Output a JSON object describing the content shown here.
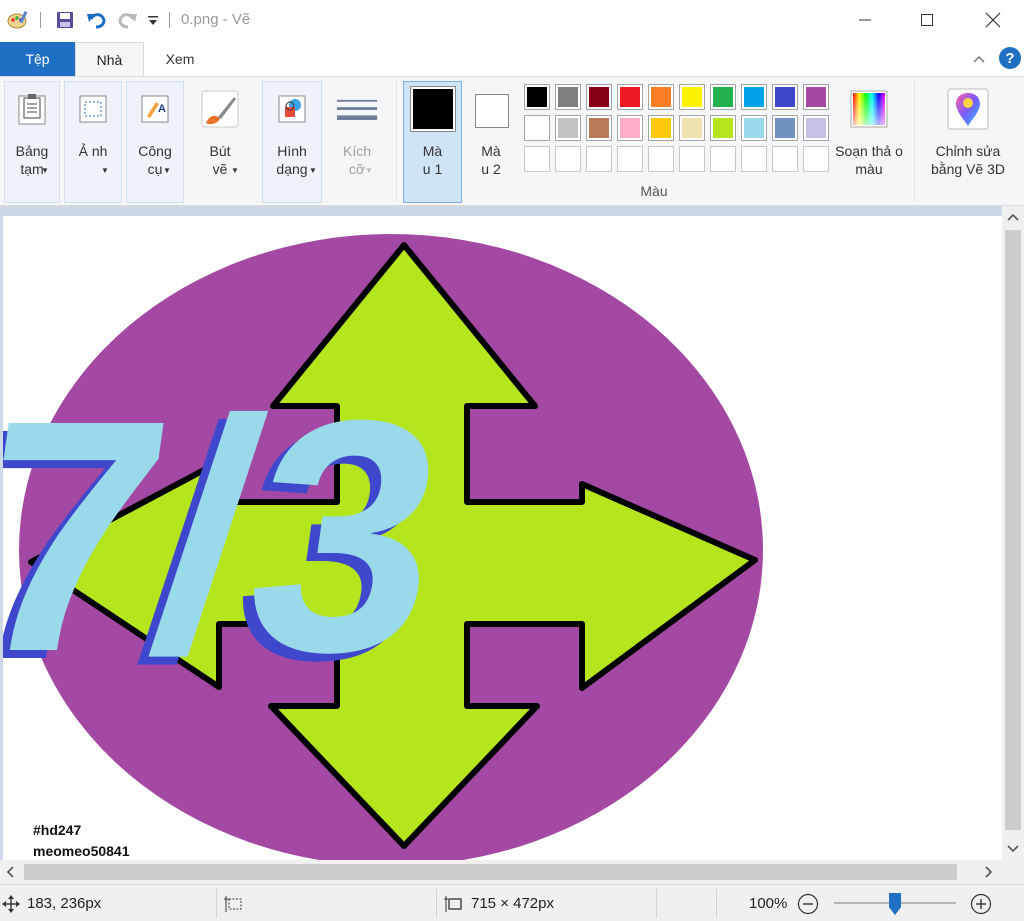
{
  "window": {
    "title": "0.png - Vẽ",
    "min_icon": "minimize-icon",
    "max_icon": "maximize-icon",
    "close_icon": "close-icon"
  },
  "tabs": [
    {
      "label": "Tệp"
    },
    {
      "label": "Nhà"
    },
    {
      "label": "Xem"
    }
  ],
  "ribbon": {
    "clipboard": "Bảng tạm",
    "image": "Ả nh",
    "tools": "Công cụ",
    "brushes": "Bút vẽ",
    "shapes": "Hình dạng",
    "size": "Kích cỡ",
    "color1": "Mà u 1",
    "color2": "Mà u 2",
    "edit_colors": "Soạn thả o màu",
    "paint3d": "Chỉnh sửa bằng Vẽ 3D",
    "colors_group": "Màu"
  },
  "palette_row1": [
    "#000000",
    "#7f7f7f",
    "#880015",
    "#ed1c24",
    "#ff7f27",
    "#fff200",
    "#22b14c",
    "#00a2e8",
    "#3f48cc",
    "#a349a4"
  ],
  "palette_row2": [
    "#ffffff",
    "#c3c3c3",
    "#b97a57",
    "#ffaec9",
    "#ffc90e",
    "#efe4b0",
    "#b5e61d",
    "#99d9ea",
    "#7092be",
    "#c8bfe7"
  ],
  "color1_value": "#000000",
  "color2_value": "#ffffff",
  "canvas": {
    "fraction_text": "7/3",
    "watermark_line1": "#hd247",
    "watermark_line2": "meomeo50841",
    "colors": {
      "ellipse": "#a349a4",
      "arrows": "#b5e61d",
      "digits": "#99d9ea",
      "digit_shadow": "#3f48cc"
    }
  },
  "status": {
    "cursor_pos": "183, 236px",
    "image_size": "715 × 472px",
    "zoom": "100%",
    "zoom_fraction": 0.5
  }
}
